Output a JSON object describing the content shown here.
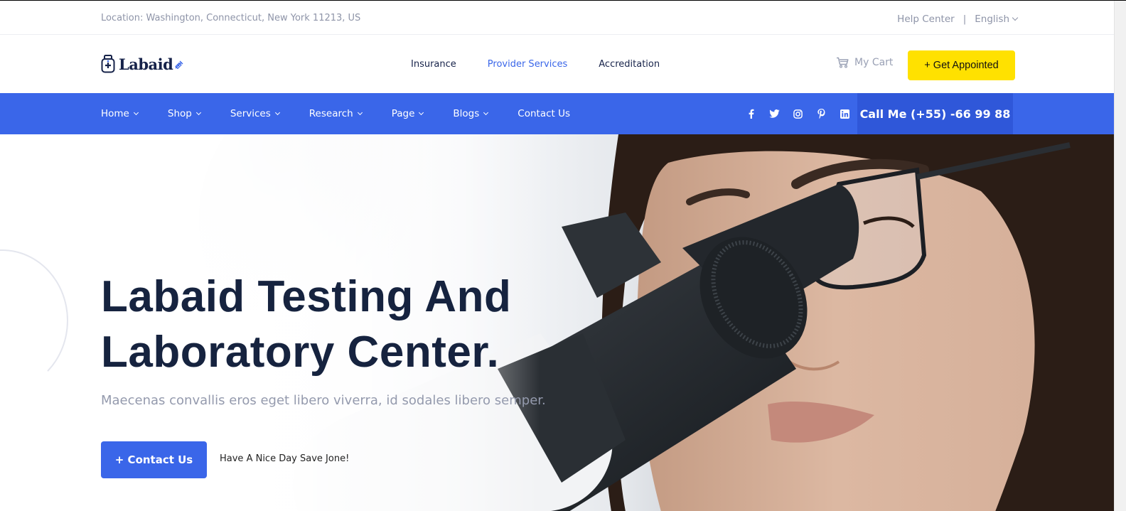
{
  "topbar": {
    "location": "Location: Washington, Connecticut, New York 11213, US",
    "help_center": "Help Center",
    "separator": "|",
    "language": "English"
  },
  "header": {
    "logo_text": "Labaid",
    "links": [
      {
        "label": "Insurance",
        "active": false
      },
      {
        "label": "Provider Services",
        "active": true
      },
      {
        "label": "Accreditation",
        "active": false
      }
    ],
    "cart_label": "My Cart",
    "cta_label": "+ Get Appointed"
  },
  "nav": {
    "items": [
      {
        "label": "Home",
        "has_dropdown": true
      },
      {
        "label": "Shop",
        "has_dropdown": true
      },
      {
        "label": "Services",
        "has_dropdown": true
      },
      {
        "label": "Research",
        "has_dropdown": true
      },
      {
        "label": "Page",
        "has_dropdown": true
      },
      {
        "label": "Blogs",
        "has_dropdown": true
      },
      {
        "label": "Contact Us",
        "has_dropdown": false
      }
    ],
    "social": [
      "facebook-icon",
      "twitter-icon",
      "instagram-icon",
      "pinterest-icon",
      "linkedin-icon"
    ],
    "call_label": "Call Me (+55) -66 99 88"
  },
  "hero": {
    "title_line1": "Labaid Testing And",
    "title_line2": "Laboratory Center.",
    "subtitle": "Maecenas convallis eros eget libero viverra, id sodales libero semper.",
    "button_label": "+ Contact Us",
    "note": "Have A Nice Day Save Jone!"
  },
  "colors": {
    "primary": "#3a66e9",
    "primary_dark": "#2f57d9",
    "cta_yellow": "#ffe100",
    "heading": "#16233f",
    "muted": "#8e94a8"
  }
}
